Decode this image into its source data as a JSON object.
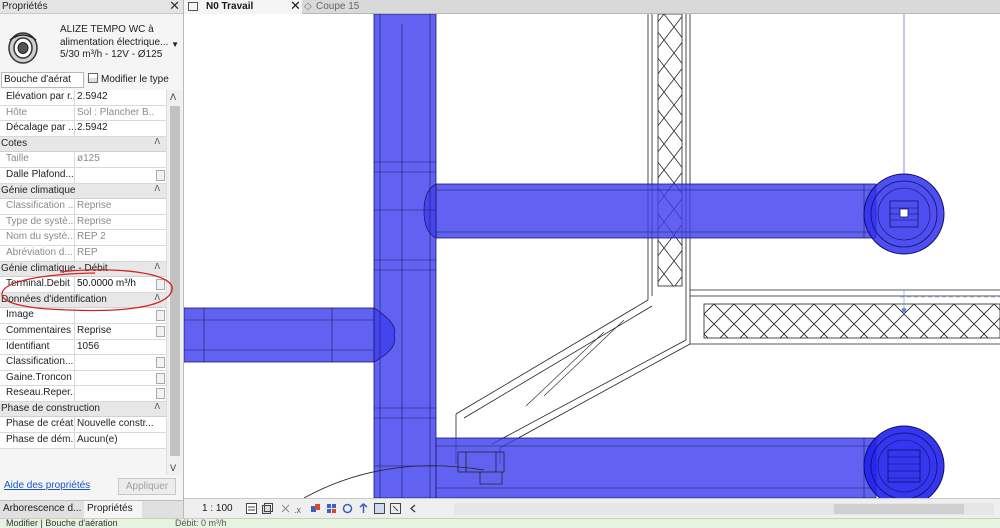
{
  "properties_panel": {
    "title": "Propriétés",
    "close_symbol": "✕",
    "type_selector": {
      "family_name": "ALIZE TEMPO WC à alimentation électrique...",
      "type_name": "5/30 m³/h - 12V - Ø125",
      "thumbnail_icon": "air-terminal-icon"
    },
    "instance_filter": "Bouche d'aérat",
    "edit_type_label": "Modifier le type",
    "rows": [
      {
        "kind": "row",
        "key": "Élévation par r...",
        "value": "2.5942",
        "readonly": false,
        "button": false
      },
      {
        "kind": "row",
        "key": "Hôte",
        "value": "Sol : Plancher B...",
        "readonly": true,
        "button": false
      },
      {
        "kind": "row",
        "key": "Décalage par ...",
        "value": "2.5942",
        "readonly": false,
        "button": false
      },
      {
        "kind": "group",
        "key": "Cotes"
      },
      {
        "kind": "row",
        "key": "Taille",
        "value": "ø125",
        "readonly": true,
        "button": false
      },
      {
        "kind": "row",
        "key": "Dalle Plafond...",
        "value": "",
        "readonly": false,
        "button": true
      },
      {
        "kind": "group",
        "key": "Génie climatique"
      },
      {
        "kind": "row",
        "key": "Classification ...",
        "value": "Reprise",
        "readonly": true,
        "button": false
      },
      {
        "kind": "row",
        "key": "Type de systè...",
        "value": "Reprise",
        "readonly": true,
        "button": false
      },
      {
        "kind": "row",
        "key": "Nom du systè...",
        "value": "REP 2",
        "readonly": true,
        "button": false
      },
      {
        "kind": "row",
        "key": "Abréviation d...",
        "value": "REP",
        "readonly": true,
        "button": false
      },
      {
        "kind": "group",
        "key": "Génie climatique - Débit"
      },
      {
        "kind": "row",
        "key": "Terminal.Debit",
        "value": "50.0000 m³/h",
        "readonly": false,
        "button": true,
        "highlight": true
      },
      {
        "kind": "group",
        "key": "Données d'identification"
      },
      {
        "kind": "row",
        "key": "Image",
        "value": "",
        "readonly": false,
        "button": true
      },
      {
        "kind": "row",
        "key": "Commentaires",
        "value": "Reprise",
        "readonly": false,
        "button": true
      },
      {
        "kind": "row",
        "key": "Identifiant",
        "value": "1056",
        "readonly": false,
        "button": false
      },
      {
        "kind": "row",
        "key": "Classification...",
        "value": "",
        "readonly": false,
        "button": true
      },
      {
        "kind": "row",
        "key": "Gaine.Troncon",
        "value": "",
        "readonly": false,
        "button": true
      },
      {
        "kind": "row",
        "key": "Reseau.Reper...",
        "value": "",
        "readonly": false,
        "button": true
      },
      {
        "kind": "group",
        "key": "Phase de construction"
      },
      {
        "kind": "row",
        "key": "Phase de créat...",
        "value": "Nouvelle constr...",
        "readonly": false,
        "button": false
      },
      {
        "kind": "row",
        "key": "Phase de dém...",
        "value": "Aucun(e)",
        "readonly": false,
        "button": false
      }
    ],
    "group_collapse_symbol": "ᐱ",
    "help_link": "Aide des propriétés",
    "apply_button": "Appliquer",
    "bottom_tabs": [
      "Arborescence d...",
      "Propriétés"
    ]
  },
  "view_tabs": [
    {
      "label": "N0 Travail",
      "active": true,
      "close": "✕"
    },
    {
      "label": "Coupe 15",
      "active": false
    }
  ],
  "view_control": {
    "scale": "1 : 100"
  },
  "status_bar": {
    "left_text": "Modifier | Bouche d'aération",
    "debit_text": "Débit: 0 m³/h"
  },
  "colors": {
    "duct_fill": "#3f3fef",
    "duct_opacity": "0.82",
    "annotation_red": "#d42222",
    "link_blue": "#1a56c5"
  }
}
